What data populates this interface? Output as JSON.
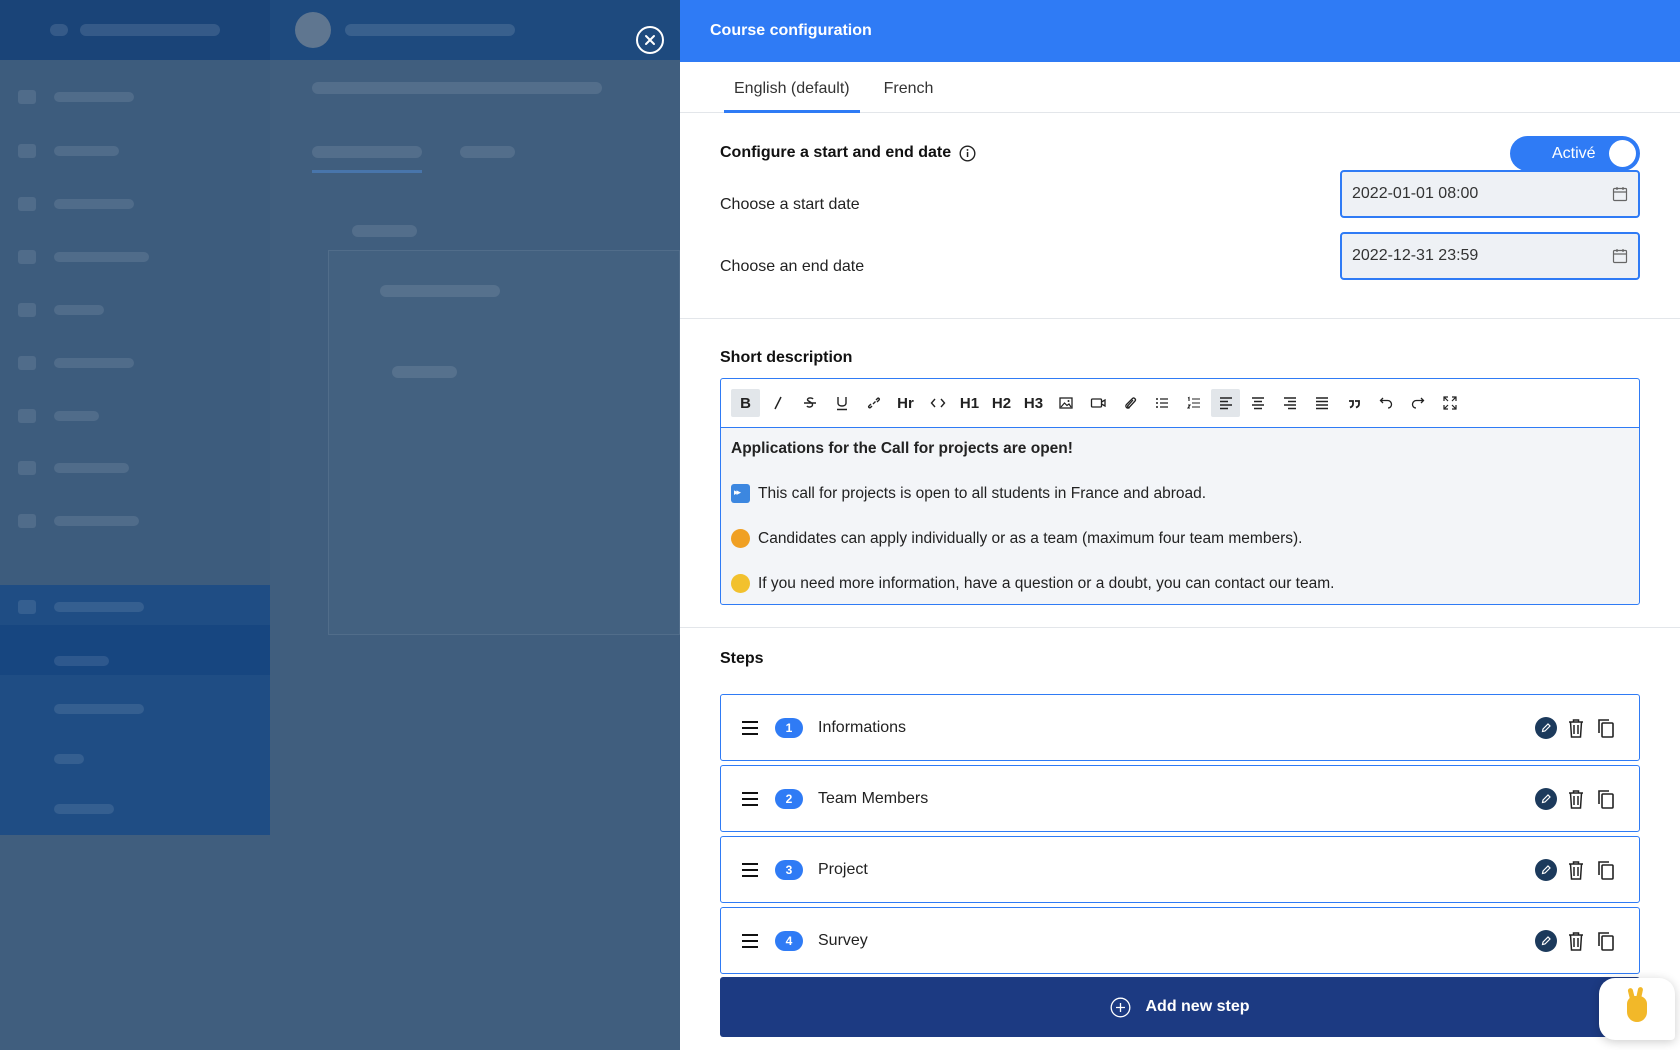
{
  "drawer": {
    "title": "Course configuration",
    "tabs": [
      {
        "label": "English (default)",
        "active": true
      },
      {
        "label": "French",
        "active": false
      }
    ]
  },
  "dates": {
    "title": "Configure a start and end date",
    "toggle_label": "Activé",
    "toggle_on": true,
    "start_label": "Choose a start date",
    "start_value": "2022-01-01 08:00",
    "end_label": "Choose an end date",
    "end_value": "2022-12-31 23:59"
  },
  "description": {
    "title": "Short description",
    "toolbar": [
      "B",
      "I",
      "S",
      "U",
      "link",
      "Hr",
      "code",
      "H1",
      "H2",
      "H3",
      "image",
      "video",
      "attachment",
      "bullet-list",
      "numbered-list",
      "align-left",
      "align-center",
      "align-right",
      "justify",
      "quote",
      "undo",
      "redo",
      "fullscreen"
    ],
    "lines": [
      {
        "text": "Applications for the Call for projects are open!",
        "icon": ""
      },
      {
        "text": "This call for projects is open to all students in France and abroad.",
        "icon": "fast-forward-emoji"
      },
      {
        "text": "Candidates can apply individually or as a team (maximum four team members).",
        "icon": "handshake-emoji"
      },
      {
        "text": "If you need more information, have a question or a doubt, you can contact our team.",
        "icon": "thinking-face-emoji"
      }
    ]
  },
  "steps": {
    "title": "Steps",
    "items": [
      {
        "number": "1",
        "name": "Informations"
      },
      {
        "number": "2",
        "name": "Team Members"
      },
      {
        "number": "3",
        "name": "Project"
      },
      {
        "number": "4",
        "name": "Survey"
      }
    ],
    "add_label": "Add new step"
  },
  "colors": {
    "accent": "#2f7bf5",
    "primary_button": "#1c3a82",
    "overlay": "#405e7e"
  },
  "icons": {
    "close": "close-icon",
    "info": "info-icon",
    "calendar": "calendar-icon",
    "chat": "victory-hand-icon"
  }
}
